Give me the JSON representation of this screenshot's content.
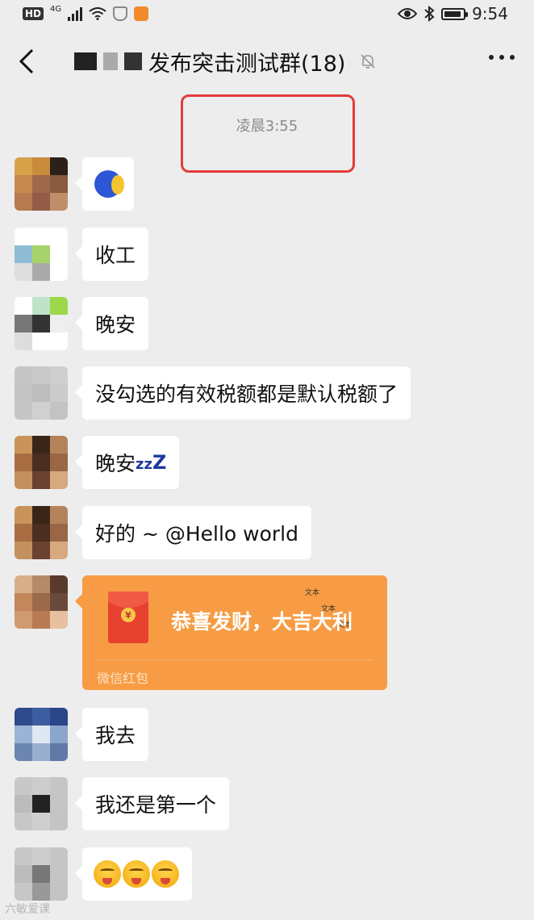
{
  "status_bar": {
    "hd": "HD",
    "network": "4G",
    "time": "9:54"
  },
  "header": {
    "title": "发布突击测试群(18)"
  },
  "timestamp": "凌晨3:55",
  "messages": [
    {
      "type": "emoji",
      "emoji": "blue-moon-emoji"
    },
    {
      "type": "text",
      "text": "收工"
    },
    {
      "type": "text",
      "text": "晚安"
    },
    {
      "type": "text",
      "text": "没勾选的有效税额都是默认税额了"
    },
    {
      "type": "text",
      "text": "晚安",
      "suffix_small": "zz",
      "suffix_big": "Z"
    },
    {
      "type": "text",
      "text": "好的 ~ @Hello world"
    },
    {
      "type": "red_packet",
      "greeting": "恭喜发财，大吉大利",
      "footer": "微信红包",
      "coin": "¥",
      "tiny1": "文本",
      "tiny2": "文本",
      "tiny3": "文本"
    },
    {
      "type": "text",
      "text": "我去"
    },
    {
      "type": "text",
      "text": "我还是第一个"
    },
    {
      "type": "emoji",
      "emoji": "grin-emoji x3"
    }
  ],
  "watermark": "六敏爱课",
  "colors": {
    "background": "#ededed",
    "bubble": "#ffffff",
    "red_packet": "#f79c44",
    "highlight": "#e53b3b"
  }
}
